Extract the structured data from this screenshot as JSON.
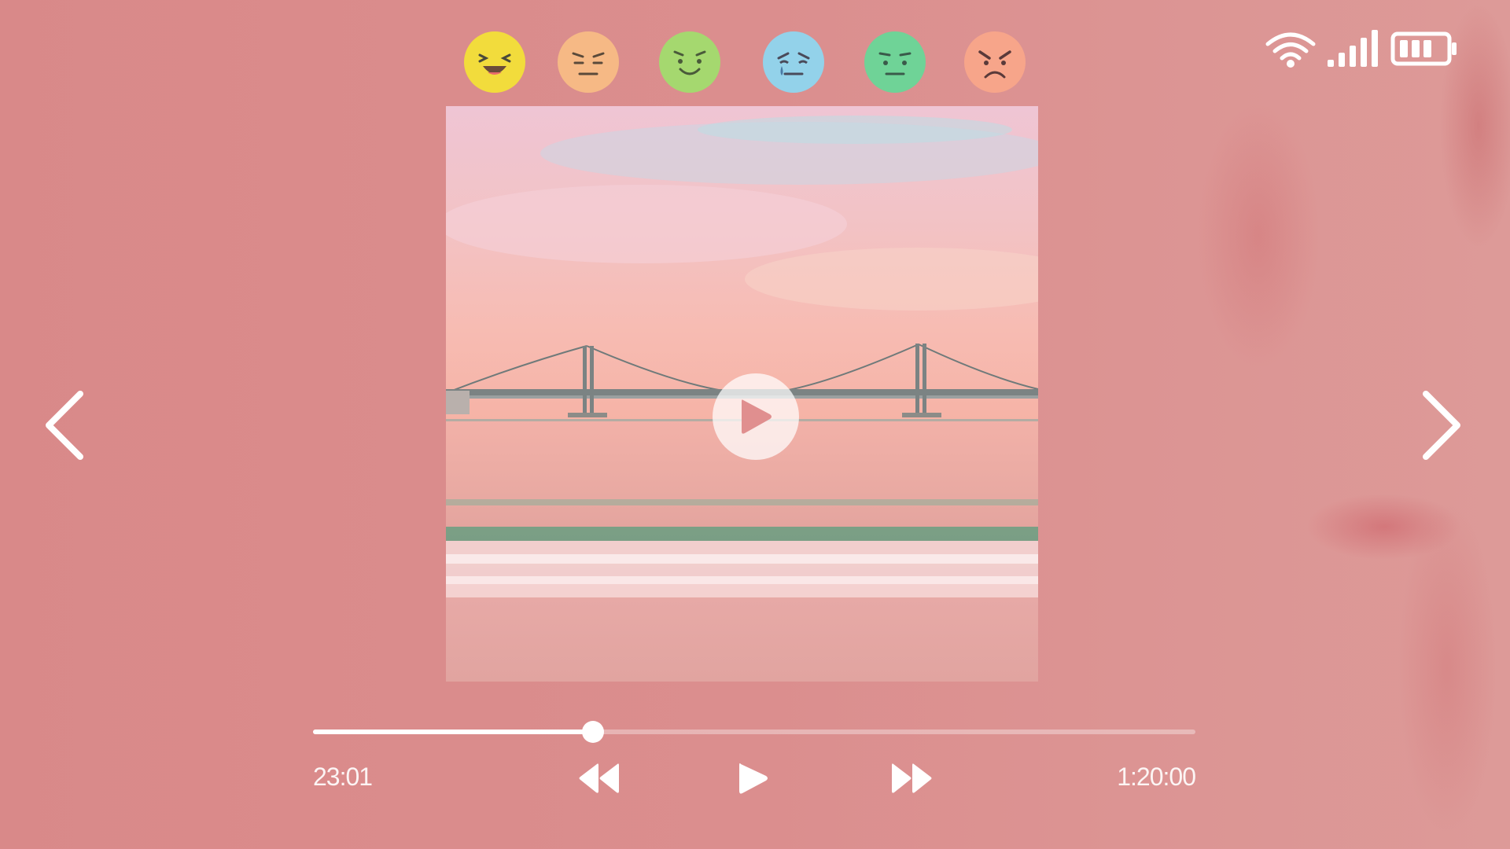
{
  "player": {
    "elapsed": "23:01",
    "duration": "1:20:00",
    "progress_fraction": 0.317
  },
  "emojis": [
    {
      "name": "laughing-emoji-icon",
      "color": "#f2dc3c"
    },
    {
      "name": "annoyed-emoji-icon",
      "color": "#f6b985"
    },
    {
      "name": "content-emoji-icon",
      "color": "#a5d86f"
    },
    {
      "name": "crying-emoji-icon",
      "color": "#93d2ea"
    },
    {
      "name": "sick-emoji-icon",
      "color": "#6fd397"
    },
    {
      "name": "angry-emoji-icon",
      "color": "#f7a58a"
    }
  ],
  "status_icons": [
    "wifi-icon",
    "signal-icon",
    "battery-icon"
  ],
  "controls": [
    "rewind-icon",
    "play-icon",
    "fast-forward-icon"
  ],
  "colors": {
    "background": "#d98b8b",
    "accent": "#ffffff"
  }
}
